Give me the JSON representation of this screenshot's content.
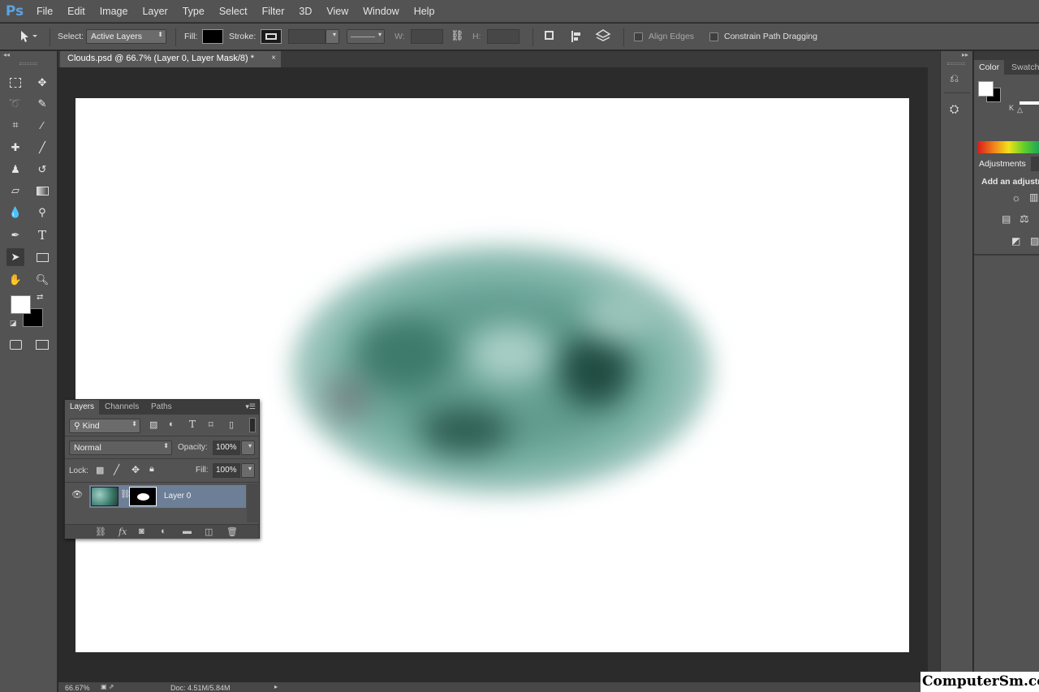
{
  "app": {
    "logo": "Ps"
  },
  "menu": [
    "File",
    "Edit",
    "Image",
    "Layer",
    "Type",
    "Select",
    "Filter",
    "3D",
    "View",
    "Window",
    "Help"
  ],
  "options": {
    "select_label": "Select:",
    "select_value": "Active Layers",
    "fill_label": "Fill:",
    "stroke_label": "Stroke:",
    "w_label": "W:",
    "h_label": "H:",
    "align_edges": "Align Edges",
    "constrain": "Constrain Path Dragging"
  },
  "document": {
    "tab_title": "Clouds.psd @ 66.7% (Layer 0, Layer Mask/8) *",
    "close": "×",
    "zoom": "66.67%",
    "doc_size": "Doc: 4.51M/5.84M"
  },
  "layers_panel": {
    "tabs": [
      "Layers",
      "Channels",
      "Paths"
    ],
    "filter_kind": "Kind",
    "blend_mode": "Normal",
    "opacity_label": "Opacity:",
    "opacity_value": "100%",
    "lock_label": "Lock:",
    "fill_label": "Fill:",
    "fill_value": "100%",
    "layer_name": "Layer 0"
  },
  "right_panels": {
    "color_tab": "Color",
    "swatches_tab": "Swatch",
    "k_label": "K",
    "adjustments_tab": "Adjustments",
    "adjust_hint": "Add an adjustm"
  },
  "colors": {
    "accent": "#5ba3e0",
    "cloud": "#5e9a8d",
    "selected_layer": "#6d7f97"
  },
  "watermark": "ComputerSm.com"
}
